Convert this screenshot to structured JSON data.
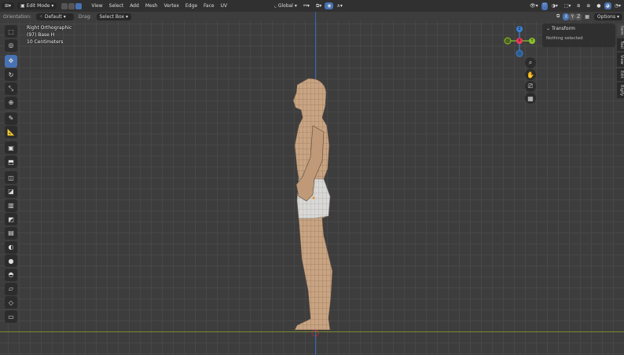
{
  "header": {
    "mode": "Edit Mode",
    "menus": [
      "View",
      "Select",
      "Add",
      "Mesh",
      "Vertex",
      "Edge",
      "Face",
      "UV"
    ],
    "transform_orientation": "Global"
  },
  "tool_header": {
    "orientation_label": "Orientation:",
    "orientation_value": "Default",
    "drag_label": "Drag:",
    "drag_value": "Select Box",
    "axes": [
      "X",
      "Y",
      "Z"
    ],
    "options_label": "Options"
  },
  "viewport_info": {
    "view": "Right Orthographic",
    "object": "(97) Base H",
    "scale": "10 Centimeters"
  },
  "gizmo": {
    "z": "Z",
    "x": "X",
    "y": "Y"
  },
  "npanel": {
    "title": "Transform",
    "empty": "Nothing selected"
  },
  "sidebar_tabs": [
    "Item",
    "Tool",
    "View",
    "Edit",
    "Rigify"
  ],
  "tools": [
    "select-box",
    "cursor",
    "move",
    "rotate",
    "scale",
    "transform",
    "annotate",
    "measure",
    "add-cube",
    "extrude",
    "inset",
    "bevel",
    "loop-cut",
    "knife",
    "poly-build",
    "spin",
    "smooth",
    "shrink",
    "shear",
    "rip",
    "edge-slide"
  ],
  "colors": {
    "accent": "#4772b3",
    "x_axis": "#f0385a",
    "y_axis": "#8bc02c",
    "z_axis": "#3a82d8"
  }
}
